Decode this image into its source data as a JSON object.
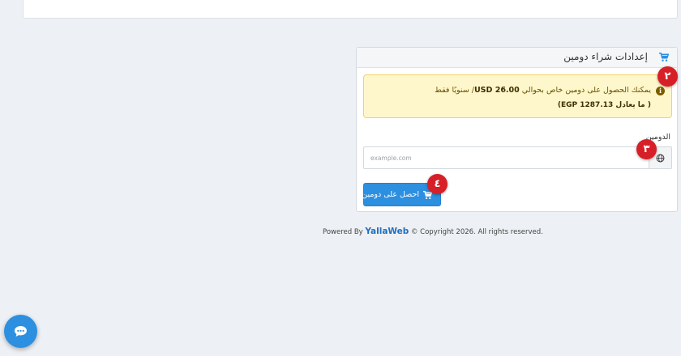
{
  "card": {
    "title": "إعدادات شراء دومين",
    "alert": {
      "line1_prefix": "يمكنك الحصول على دومين خاص بحوالي",
      "price": "USD 26.00",
      "line1_suffix": "/ سنويًا فقط",
      "line2": "( ما يعادل EGP 1287.13)"
    },
    "domain_label": "الدومين",
    "domain_placeholder": "example.com",
    "submit_label": "احصل على دومين"
  },
  "markers": [
    "٢",
    "٣",
    "٤"
  ],
  "footer": {
    "powered_by": "Powered By",
    "brand": "YallaWeb",
    "rights": "© Copyright 2026. All rights reserved."
  },
  "colors": {
    "accent": "#2d8fe0",
    "marker": "#d61f26",
    "alert_bg": "#fff7cc",
    "alert_border": "#f4d166"
  },
  "icons": [
    "cart-icon",
    "info-icon",
    "globe-icon",
    "chat-icon"
  ]
}
